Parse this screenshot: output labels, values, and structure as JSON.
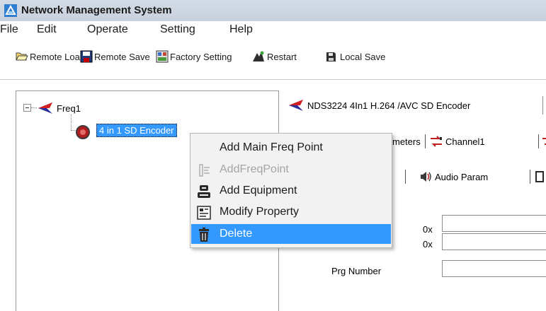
{
  "window": {
    "title": "Network Management System",
    "icon": "network-app-icon"
  },
  "menubar": {
    "items": [
      "File",
      "Edit",
      "Operate",
      "Setting",
      "Help"
    ]
  },
  "toolbar": {
    "remote_load": "Remote Load",
    "remote_save": "Remote Save",
    "factory_setting": "Factory Setting",
    "restart": "Restart",
    "local_save": "Local Save"
  },
  "tree": {
    "root_label": "Freq1",
    "node_label": "4 in 1 SD Encoder"
  },
  "device_panel": {
    "title": "NDS3224 4In1 H.264 /AVC SD Encoder",
    "tabs": {
      "parameters_fragment": "meters",
      "channel1": "Channel1"
    },
    "subtabs": {
      "audio_param": "Audio Param"
    },
    "fields": {
      "hex_prefix_1": "0x",
      "hex_prefix_2": "0x",
      "prg_number_label": "Prg Number"
    }
  },
  "context_menu": {
    "items": [
      {
        "label": "Add Main Freq Point",
        "icon": "",
        "state": "normal"
      },
      {
        "label": "AddFreqPoint",
        "icon": "add-freq-point-icon",
        "state": "disabled"
      },
      {
        "label": "Add Equipment",
        "icon": "add-equipment-icon",
        "state": "normal"
      },
      {
        "label": "Modify Property",
        "icon": "modify-property-icon",
        "state": "normal"
      },
      {
        "label": "Delete",
        "icon": "trash-icon",
        "state": "selected"
      }
    ]
  },
  "colors": {
    "selection": "#3399ff",
    "titlebar": "#cdd5e1",
    "menu_bg": "#f2f2f2",
    "disabled_text": "#a5a5a5"
  }
}
